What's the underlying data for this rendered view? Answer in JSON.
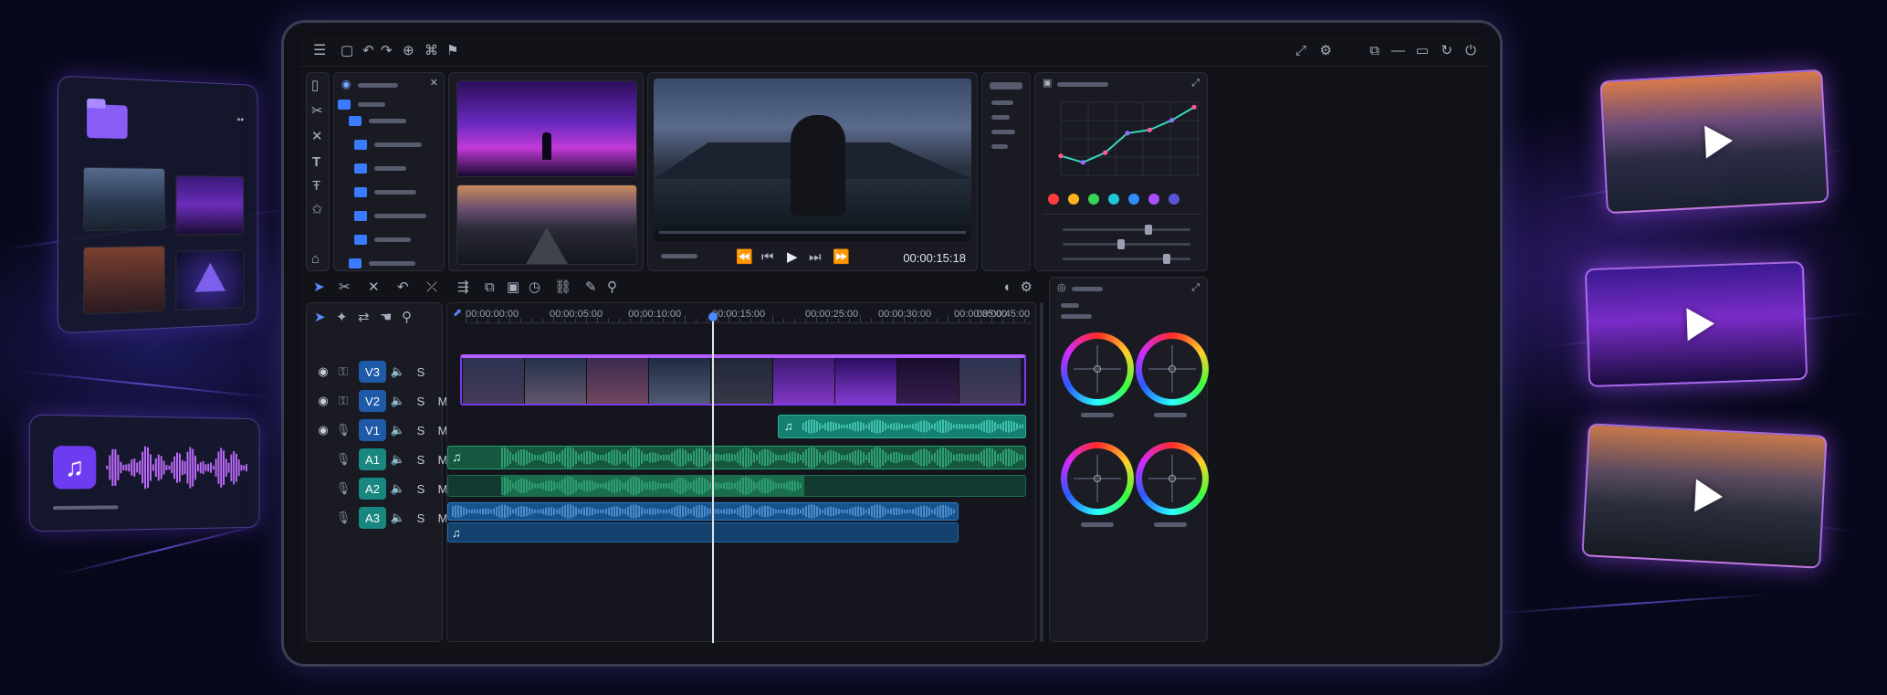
{
  "timeline": {
    "tracks": [
      {
        "name": "V1",
        "kind": "video"
      },
      {
        "name": "V2",
        "kind": "video"
      },
      {
        "name": "V3",
        "kind": "video"
      },
      {
        "name": "A1",
        "kind": "audio"
      },
      {
        "name": "A2",
        "kind": "audio"
      },
      {
        "name": "A3",
        "kind": "audio"
      }
    ],
    "solo_label": "S",
    "mute_label": "M",
    "ruler_ticks": [
      "00:00:00:00",
      "00:00:05:00",
      "00:00:10:00",
      "00:00:15:00",
      "00:00:25:00",
      "00:00:30:00",
      "00:00:35:00",
      "00:00:45:00"
    ],
    "playhead_timecode": "00:00:15:00"
  },
  "viewer": {
    "timecode": "00:00:15:18"
  },
  "colors": {
    "accent": "#8b5cf6",
    "video_clip": "#7c3aed",
    "audio_green": "#1f9e72",
    "audio_teal": "#19a38e",
    "audio_blue": "#1e6fb8",
    "track_badge": "#1f5aa8"
  },
  "icons": {
    "menu": "hamburger-icon",
    "selection": "arrow-pointer-icon",
    "razor": "scissors-icon",
    "text": "text-tool-icon",
    "music": "music-note-icon",
    "folder": "folder-icon",
    "eye": "eye-icon",
    "lock": "lock-icon",
    "mic": "microphone-icon",
    "speaker": "speaker-icon"
  },
  "chart_data": {
    "type": "line",
    "x": [
      0,
      1,
      2,
      3,
      4,
      5,
      6
    ],
    "series": [
      {
        "values": [
          1.2,
          0.8,
          1.4,
          2.6,
          2.8,
          3.4,
          4.2
        ]
      }
    ]
  },
  "swatches": [
    "#ff3b3b",
    "#ffb21e",
    "#39d353",
    "#22c5d6",
    "#2f8cff",
    "#a84dff",
    "#5a56d6"
  ]
}
